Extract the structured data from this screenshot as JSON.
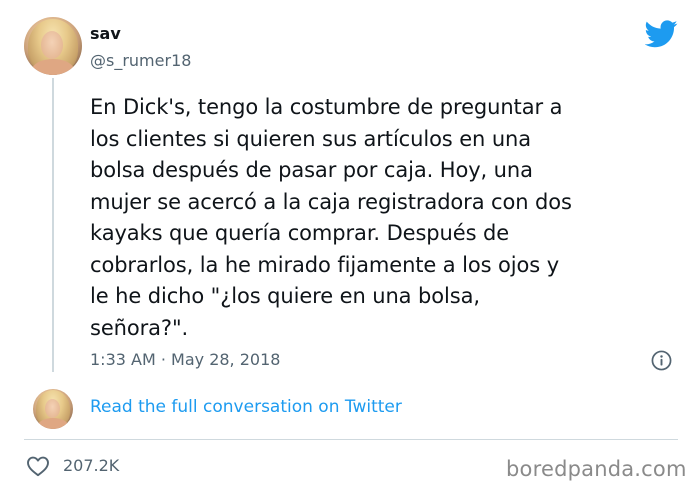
{
  "author": {
    "name": "sav",
    "handle": "@s_rumer18"
  },
  "tweet": {
    "text": "En Dick's, tengo la costumbre de preguntar a\nlos clientes si quieren sus artículos en una\nbolsa después de pasar por caja. Hoy, una\nmujer se acercó a la caja registradora con dos\nkayaks que quería comprar. Después de\ncobrarlos, la he mirado fijamente a los ojos y\nle he dicho \"¿los quiere en una bolsa,\nseñora?\".",
    "timestamp": "1:33 AM · May 28, 2018"
  },
  "conversation_link": "Read the full conversation on Twitter",
  "likes": "207.2K",
  "watermark": "boredpanda.com",
  "colors": {
    "twitter_blue": "#1d9bf0",
    "secondary_text": "#536471",
    "divider": "#cfd9de"
  },
  "icons": [
    "twitter-bird-icon",
    "info-icon",
    "heart-icon"
  ]
}
